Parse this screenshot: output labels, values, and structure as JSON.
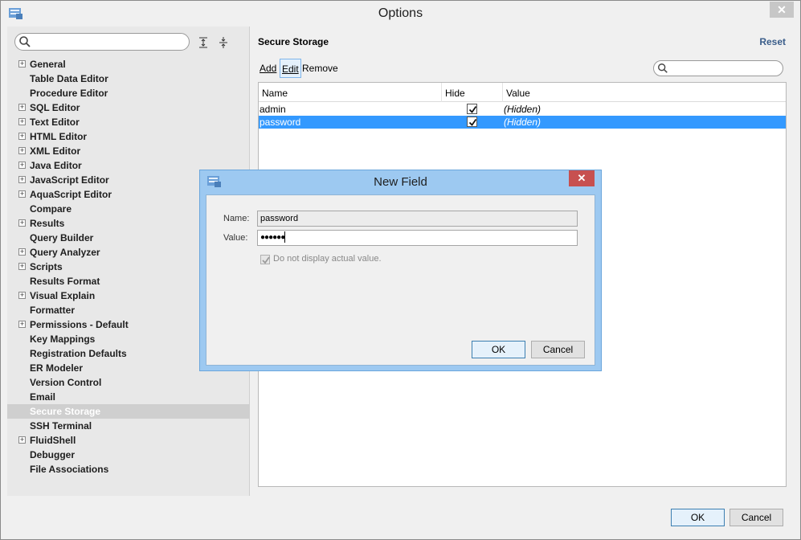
{
  "window": {
    "title": "Options",
    "close_glyph": "✕"
  },
  "left_panel": {
    "search": {
      "placeholder": "",
      "value": ""
    },
    "tree": [
      {
        "label": "General",
        "expandable": true
      },
      {
        "label": "Table Data Editor",
        "expandable": false
      },
      {
        "label": "Procedure Editor",
        "expandable": false
      },
      {
        "label": "SQL Editor",
        "expandable": true
      },
      {
        "label": "Text Editor",
        "expandable": true
      },
      {
        "label": "HTML Editor",
        "expandable": true
      },
      {
        "label": "XML Editor",
        "expandable": true
      },
      {
        "label": "Java Editor",
        "expandable": true
      },
      {
        "label": "JavaScript Editor",
        "expandable": true
      },
      {
        "label": "AquaScript Editor",
        "expandable": true
      },
      {
        "label": "Compare",
        "expandable": false
      },
      {
        "label": "Results",
        "expandable": true
      },
      {
        "label": "Query Builder",
        "expandable": false
      },
      {
        "label": "Query Analyzer",
        "expandable": true
      },
      {
        "label": "Scripts",
        "expandable": true
      },
      {
        "label": "Results Format",
        "expandable": false
      },
      {
        "label": "Visual Explain",
        "expandable": true
      },
      {
        "label": "Formatter",
        "expandable": false
      },
      {
        "label": "Permissions - Default",
        "expandable": true
      },
      {
        "label": "Key Mappings",
        "expandable": false
      },
      {
        "label": "Registration Defaults",
        "expandable": false
      },
      {
        "label": "ER Modeler",
        "expandable": false
      },
      {
        "label": "Version Control",
        "expandable": false
      },
      {
        "label": "Email",
        "expandable": false
      },
      {
        "label": "Secure Storage",
        "expandable": false,
        "selected": true
      },
      {
        "label": "SSH Terminal",
        "expandable": false
      },
      {
        "label": "FluidShell",
        "expandable": true
      },
      {
        "label": "Debugger",
        "expandable": false
      },
      {
        "label": "File Associations",
        "expandable": false
      }
    ]
  },
  "content": {
    "title": "Secure Storage",
    "reset_label": "Reset",
    "toolbar": {
      "add_label": "Add",
      "edit_label": "Edit",
      "remove_label": "Remove"
    },
    "filter": {
      "placeholder": "",
      "value": ""
    },
    "table": {
      "columns": [
        "Name",
        "Hide",
        "Value"
      ],
      "rows": [
        {
          "name": "admin",
          "hide": true,
          "value": "(Hidden)",
          "selected": false
        },
        {
          "name": "password",
          "hide": true,
          "value": "(Hidden)",
          "selected": true
        }
      ]
    }
  },
  "footer": {
    "ok_label": "OK",
    "cancel_label": "Cancel"
  },
  "dialog": {
    "title": "New Field",
    "close_glyph": "✕",
    "name_label": "Name:",
    "name_value": "password",
    "value_label": "Value:",
    "value_masked": "●●●●●●",
    "checkbox_label": "Do not display actual value.",
    "checkbox_checked": true,
    "ok_label": "OK",
    "cancel_label": "Cancel"
  },
  "colors": {
    "selection": "#3399ff",
    "reset_link": "#3a5d8a",
    "dialog_frame": "#9dc9f1",
    "dialog_close": "#c75050"
  }
}
